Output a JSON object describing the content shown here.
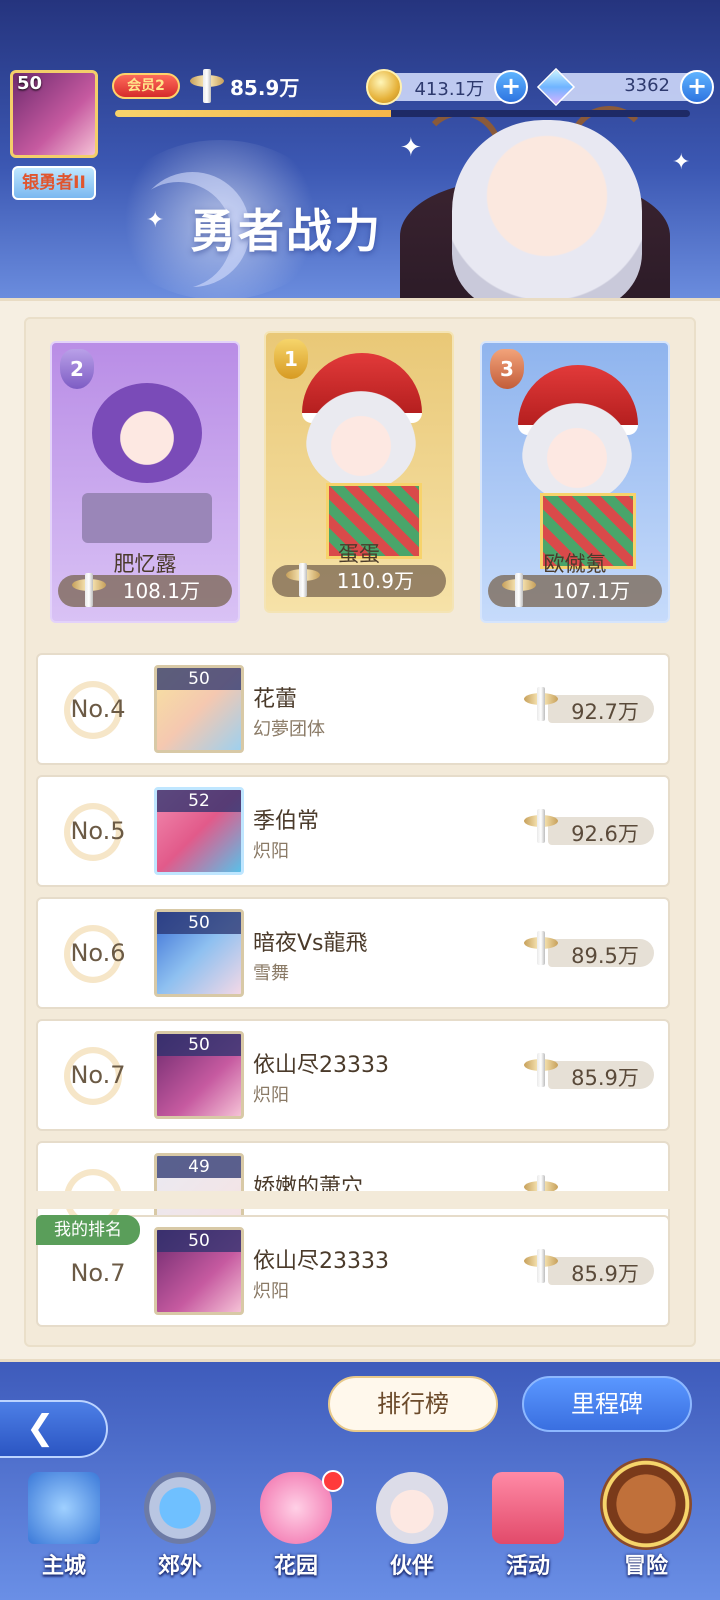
{
  "header": {
    "avatar_level": "50",
    "rank_title": "银勇者II",
    "vip_label": "会员2",
    "power": "85.9万",
    "progress": 0.48,
    "coins": "413.1万",
    "gems": "3362",
    "page_title": "勇者战力"
  },
  "podium": [
    {
      "rank": "2",
      "name": "肥忆露",
      "power": "108.1万",
      "color": "#c9a8f0"
    },
    {
      "rank": "1",
      "name": "蛋蛋",
      "power": "110.9万",
      "color": "#f3d98c"
    },
    {
      "rank": "3",
      "name": "欧僦氪",
      "power": "107.1万",
      "color": "#a8c8f5"
    }
  ],
  "rows": [
    {
      "no": "No.4",
      "level": "50",
      "name": "花蕾",
      "guild": "幻夢团体",
      "power": "92.7万"
    },
    {
      "no": "No.5",
      "level": "52",
      "name": "季伯常",
      "guild": "炽阳",
      "power": "92.6万"
    },
    {
      "no": "No.6",
      "level": "50",
      "name": "暗夜Vs龍飛",
      "guild": "雪舞",
      "power": "89.5万"
    },
    {
      "no": "No.7",
      "level": "50",
      "name": "依山尽23333",
      "guild": "炽阳",
      "power": "85.9万"
    },
    {
      "no": "",
      "level": "49",
      "name": "娇嫩的萧穴",
      "guild": "",
      "power": ""
    }
  ],
  "my_rank": {
    "tag": "我的排名",
    "no": "No.7",
    "level": "50",
    "name": "依山尽23333",
    "guild": "炽阳",
    "power": "85.9万"
  },
  "bottom": {
    "ranking_label": "排行榜",
    "milestone_label": "里程碑"
  },
  "nav": [
    {
      "label": "主城",
      "icon": "castle-icon"
    },
    {
      "label": "郊外",
      "icon": "portal-icon"
    },
    {
      "label": "花园",
      "icon": "heart-icon"
    },
    {
      "label": "伙伴",
      "icon": "partner-icon"
    },
    {
      "label": "活动",
      "icon": "gift-icon"
    },
    {
      "label": "冒险",
      "icon": "compass-icon"
    }
  ]
}
